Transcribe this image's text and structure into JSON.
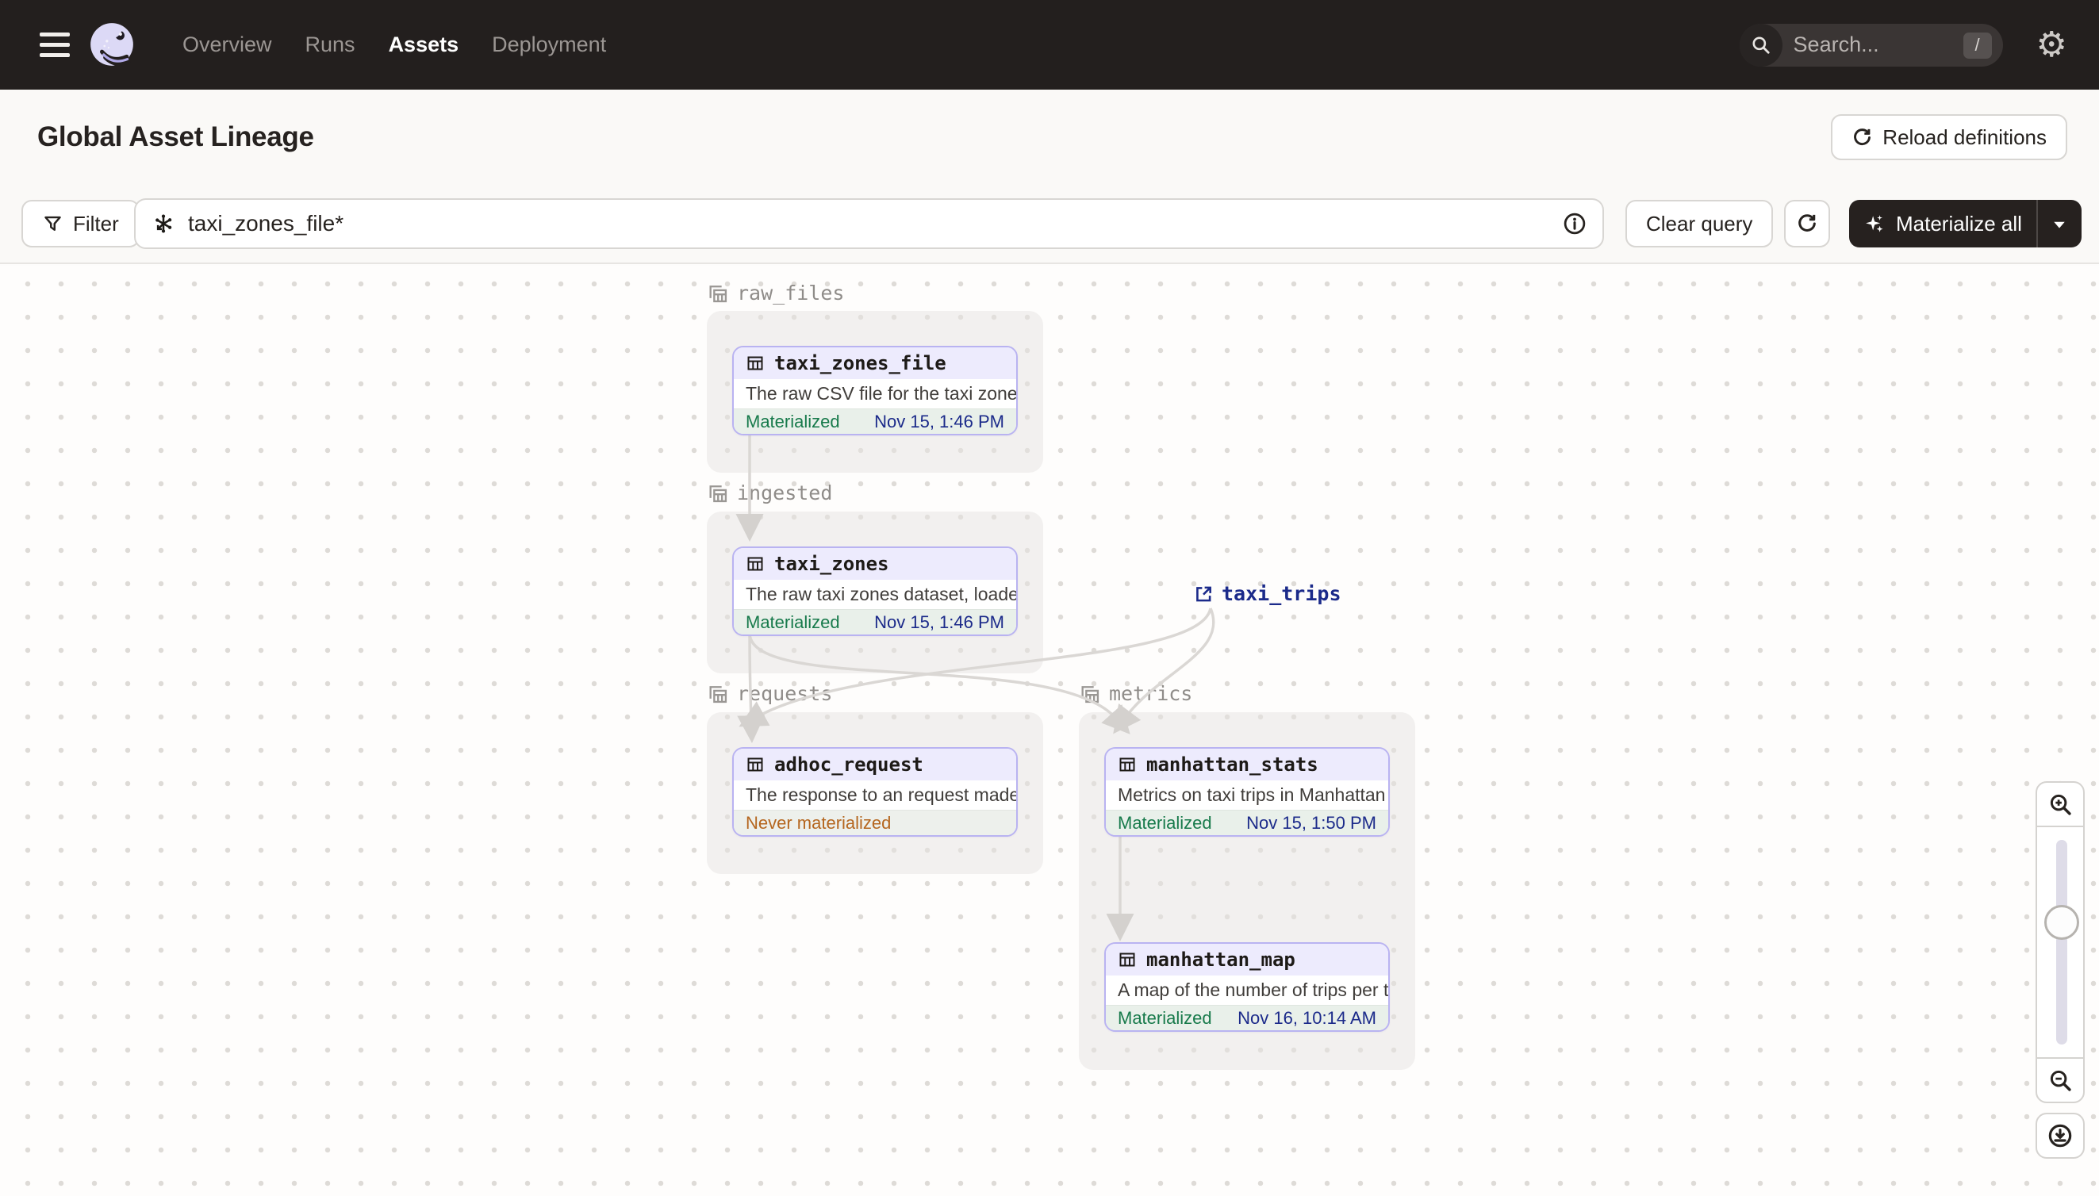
{
  "nav": {
    "items": [
      "Overview",
      "Runs",
      "Assets",
      "Deployment"
    ],
    "active_item": "Assets",
    "search": {
      "placeholder": "Search...",
      "shortcut": "/"
    }
  },
  "header": {
    "title": "Global Asset Lineage",
    "reload_button": "Reload definitions"
  },
  "toolbar": {
    "filter_button": "Filter",
    "query_value": "taxi_zones_file*",
    "clear_button": "Clear query",
    "materialize_button": "Materialize all"
  },
  "graph": {
    "groups": [
      {
        "label": "raw_files"
      },
      {
        "label": "ingested"
      },
      {
        "label": "requests"
      },
      {
        "label": "metrics"
      }
    ],
    "nodes": [
      {
        "name": "taxi_zones_file",
        "description": "The raw CSV file for the taxi zones dat...",
        "status": "Materialized",
        "timestamp": "Nov 15, 1:46 PM",
        "group": "raw_files"
      },
      {
        "name": "taxi_zones",
        "description": "The raw taxi zones dataset, loaded int...",
        "status": "Materialized",
        "timestamp": "Nov 15, 1:46 PM",
        "group": "ingested"
      },
      {
        "name": "adhoc_request",
        "description": "The response to an request made in th...",
        "status": "Never materialized",
        "timestamp": "",
        "group": "requests"
      },
      {
        "name": "manhattan_stats",
        "description": "Metrics on taxi trips in Manhattan",
        "status": "Materialized",
        "timestamp": "Nov 15, 1:50 PM",
        "group": "metrics"
      },
      {
        "name": "manhattan_map",
        "description": "A map of the number of trips per taxi z...",
        "status": "Materialized",
        "timestamp": "Nov 16, 10:14 AM",
        "group": "metrics"
      }
    ],
    "external": {
      "name": "taxi_trips"
    },
    "edges": [
      "taxi_zones_file->taxi_zones",
      "taxi_zones->adhoc_request",
      "taxi_zones->manhattan_stats",
      "taxi_trips->adhoc_request",
      "taxi_trips->manhattan_stats",
      "manhattan_stats->manhattan_map"
    ]
  },
  "icons": {
    "menu": "hamburger",
    "logo": "dagster-octopus",
    "search": "magnifier",
    "settings": "gear",
    "reload": "circular-arrow",
    "filter": "funnel",
    "query": "graph-asterisk",
    "info": "info-circle",
    "refresh": "circular-arrow",
    "materialize": "sparkle",
    "dropdown": "caret-down",
    "asset": "table-grid",
    "group": "stacked-tables",
    "external_asset": "external-link",
    "zoom_in": "magnifier-plus",
    "zoom_out": "magnifier-minus",
    "download": "download-circle"
  },
  "colors": {
    "nav_bg": "#231f1e",
    "page_bg": "#faf9f7",
    "node_border": "#b9b3f1",
    "node_header": "#edebfd",
    "status_green": "#177a4b",
    "status_orange": "#b5661f",
    "timestamp_navy": "#1b2a8a",
    "edge_gray": "#d9d6d3",
    "dark_button": "#26211f"
  }
}
